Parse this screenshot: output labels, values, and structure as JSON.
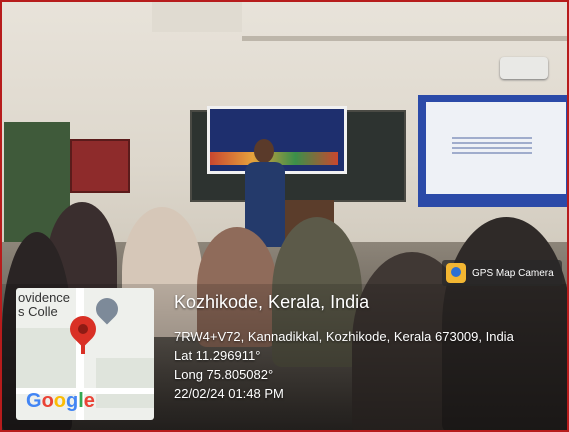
{
  "location": {
    "title": "Kozhikode, Kerala, India",
    "address": "7RW4+V72, Kannadikkal, Kozhikode, Kerala 673009, India",
    "lat": "Lat 11.296911°",
    "long": "Long 75.805082°",
    "datetime": "22/02/24 01:48 PM"
  },
  "badge": {
    "label": "GPS Map Camera",
    "icon": "gps-map-camera-icon"
  },
  "map": {
    "place_text_1": "ovidence",
    "place_text_2": "s Colle",
    "provider": "Google",
    "pin_icon": "location-pin-icon",
    "pin_color": "#d93025"
  },
  "banner": {
    "icon": "event-banner"
  },
  "colors": {
    "frame_border": "#b71c1c",
    "google_blue": "#4285f4",
    "google_red": "#ea4335",
    "google_yellow": "#fbbc05",
    "google_green": "#34a853"
  }
}
